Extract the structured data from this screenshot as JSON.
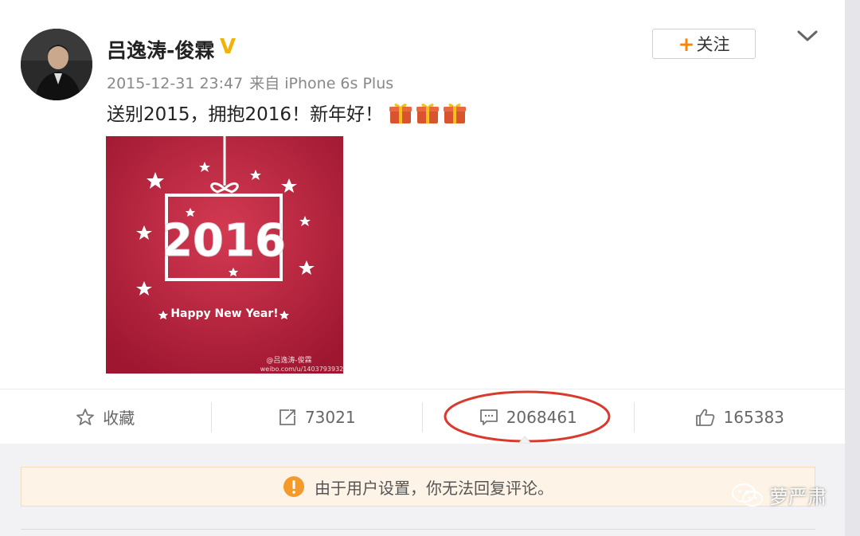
{
  "colors": {
    "accent_orange": "#ff8200",
    "verified_gold": "#f2b20c",
    "annotation_red": "#d93a2e",
    "poster_red": "#b5213a",
    "notice_bg": "#fdf3e6"
  },
  "post": {
    "username": "吕逸涛-俊霖",
    "verified_badge": "V",
    "timestamp": "2015-12-31 23:47",
    "source": "来自 iPhone 6s Plus",
    "text": "送别2015，拥抱2016！新年好！",
    "gift_emoji_count": 3,
    "image": {
      "year_text": "2016",
      "caption": "Happy New Year!",
      "watermark_line1": "@吕逸涛-俊霖",
      "watermark_line2": "weibo.com/u/1403793932"
    }
  },
  "header": {
    "follow_plus": "+",
    "follow_label": "关注",
    "menu_icon": "chevron-down-icon"
  },
  "actions": {
    "favorite_label": "收藏",
    "repost_count": "73021",
    "comment_count": "2068461",
    "like_count": "165383"
  },
  "notice": {
    "text": "由于用户设置，你无法回复评论。"
  },
  "watermark": {
    "text": "萝严肃"
  }
}
